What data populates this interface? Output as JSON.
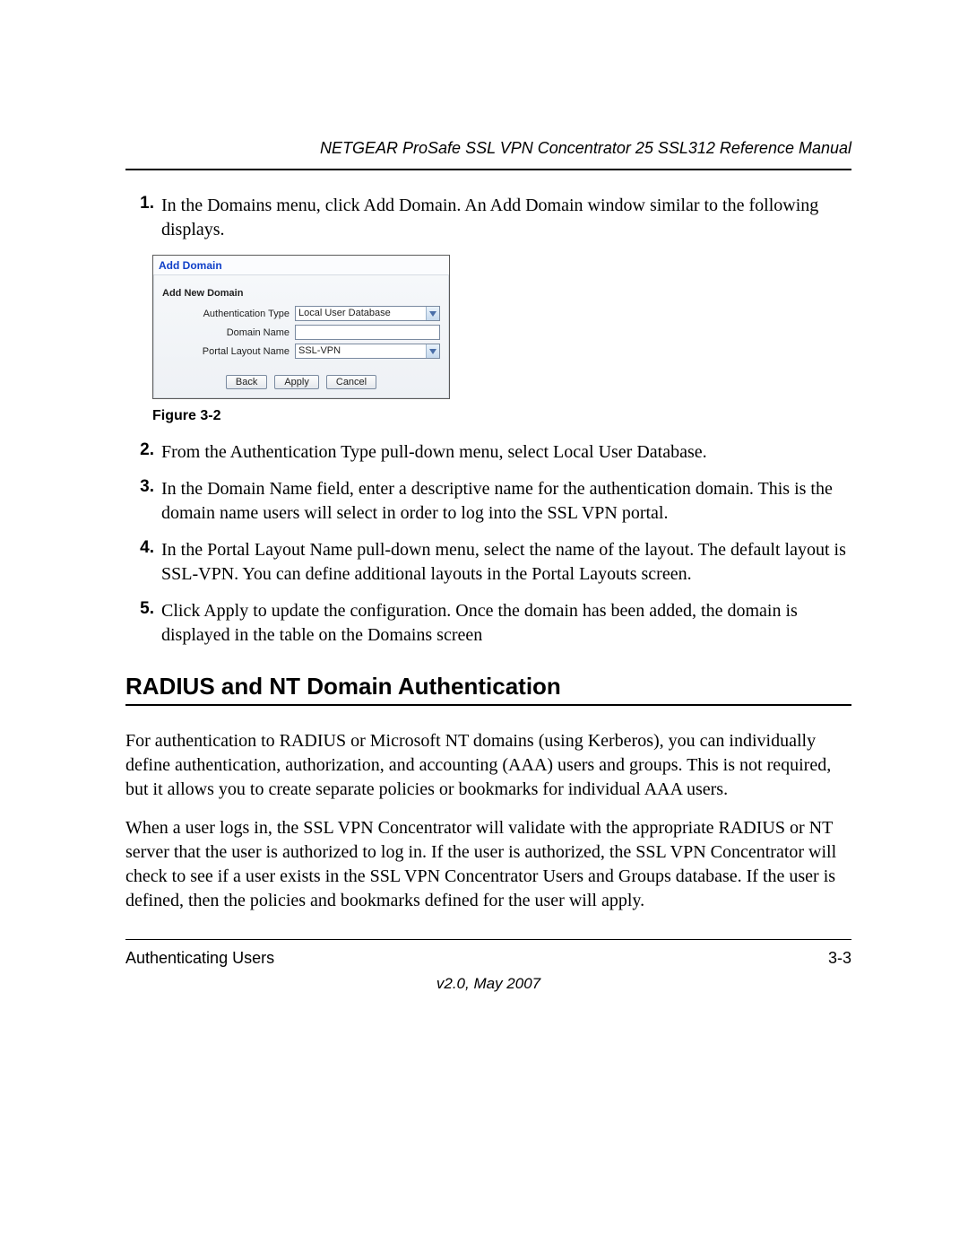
{
  "header": {
    "title": "NETGEAR ProSafe SSL VPN Concentrator 25 SSL312 Reference Manual"
  },
  "steps": [
    {
      "num": "1.",
      "text": "In the Domains menu, click Add Domain. An Add Domain window similar to the following displays."
    },
    {
      "num": "2.",
      "text": "From the Authentication Type pull-down menu, select Local User Database."
    },
    {
      "num": "3.",
      "text": "In the Domain Name field, enter a descriptive name for the authentication domain. This is the domain name users will select in order to log into the SSL VPN portal."
    },
    {
      "num": "4.",
      "text": "In the Portal Layout Name pull-down menu, select the name of the layout. The default layout is SSL-VPN. You can define additional layouts in the Portal Layouts screen."
    },
    {
      "num": "5.",
      "text": "Click Apply to update the configuration. Once the domain has been added, the domain is displayed in the table on the Domains screen"
    }
  ],
  "dialog": {
    "title": "Add Domain",
    "subtitle": "Add New Domain",
    "fields": {
      "auth_type_label": "Authentication Type",
      "auth_type_value": "Local User Database",
      "domain_name_label": "Domain Name",
      "domain_name_value": "",
      "portal_layout_label": "Portal Layout Name",
      "portal_layout_value": "SSL-VPN"
    },
    "buttons": {
      "back": "Back",
      "apply": "Apply",
      "cancel": "Cancel"
    }
  },
  "figure_caption": "Figure 3-2",
  "section_heading": "RADIUS and NT Domain Authentication",
  "paragraphs": {
    "p1": "For authentication to RADIUS or Microsoft NT domains (using Kerberos), you can individually define authentication, authorization, and accounting (AAA) users and groups. This is not required, but it allows you to create separate policies or bookmarks for individual AAA users.",
    "p2": "When a user logs in, the SSL VPN Concentrator will validate with the appropriate RADIUS or NT server that the user is authorized to log in. If the user is authorized, the SSL VPN Concentrator will check to see if a user exists in the SSL VPN Concentrator Users and Groups database. If the user is defined, then the policies and bookmarks defined for the user will apply."
  },
  "footer": {
    "section": "Authenticating Users",
    "page": "3-3",
    "version": "v2.0, May 2007"
  }
}
